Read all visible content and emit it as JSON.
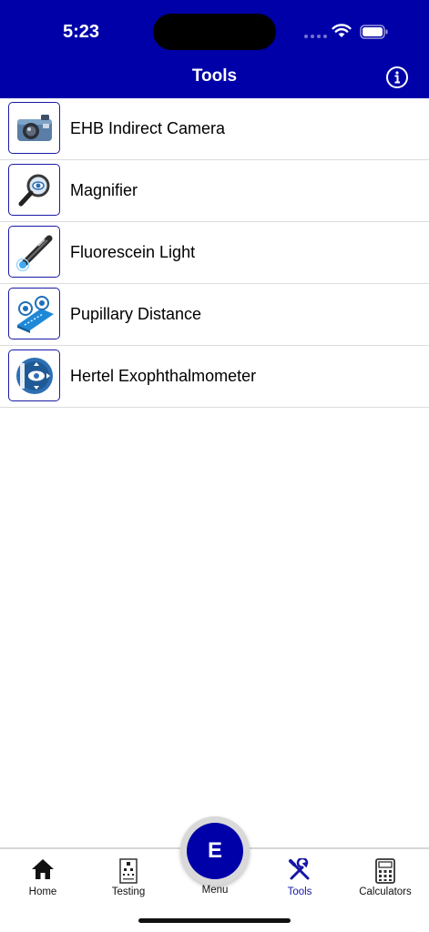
{
  "status_bar": {
    "time": "5:23"
  },
  "header": {
    "title": "Tools"
  },
  "tools": [
    {
      "label": "EHB Indirect Camera",
      "icon": "camera-icon"
    },
    {
      "label": "Magnifier",
      "icon": "magnifier-icon"
    },
    {
      "label": "Fluorescein Light",
      "icon": "penlight-icon"
    },
    {
      "label": "Pupillary Distance",
      "icon": "pupillary-distance-icon"
    },
    {
      "label": "Hertel Exophthalmometer",
      "icon": "exophthalmometer-icon"
    }
  ],
  "tabbar": {
    "home": "Home",
    "testing": "Testing",
    "menu": "Menu",
    "menu_letter": "E",
    "tools": "Tools",
    "calculators": "Calculators",
    "active": "tools"
  },
  "colors": {
    "brand": "#0000a8",
    "active_tab": "#1515a6"
  }
}
